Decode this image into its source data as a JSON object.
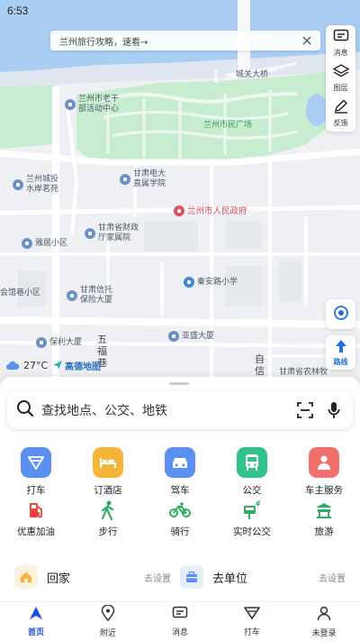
{
  "status_bar": {
    "time": "6:53"
  },
  "banner": {
    "text": "兰州旅行攻略，速看→"
  },
  "right_tools": [
    {
      "label": "消息",
      "icon": "message-icon"
    },
    {
      "label": "图层",
      "icon": "layers-icon"
    },
    {
      "label": "反馈",
      "icon": "feedback-icon"
    }
  ],
  "route_button": {
    "label": "路线"
  },
  "weather": {
    "temp": "27°C"
  },
  "map_logo": {
    "text": "高德地图"
  },
  "map_labels": {
    "bridge": "城关大桥",
    "senior_center": "兰州市老干\n部活动中心",
    "square": "兰州市民广场",
    "gansu_tv": "甘肃电大\n直属学院",
    "chengqiao": "兰州城投\n水岸茗苑",
    "gov": "兰州市人民政府",
    "finance": "甘肃省财政\n厅家属院",
    "yaju": "雅居小区",
    "qinan": "秦安路小学",
    "xintuo": "甘肃信托\n保险大厦",
    "huiguan": "会馆巷小区",
    "baoli": "保利大厦",
    "yasheng": "亚盛大厦",
    "wufu": "五\n福\n巷",
    "zixin": "自\n信\n路",
    "nongke": "甘肃省农林牧\n三厅家属院"
  },
  "search": {
    "placeholder": "查找地点、公交、地铁"
  },
  "services_primary": [
    {
      "label": "打车",
      "icon": "taxi-icon",
      "color": "#5a8ef0"
    },
    {
      "label": "订酒店",
      "icon": "hotel-icon",
      "color": "#f5b53a"
    },
    {
      "label": "驾车",
      "icon": "car-icon",
      "color": "#5b8ff0"
    },
    {
      "label": "公交",
      "icon": "bus-icon",
      "color": "#2fc28a"
    },
    {
      "label": "车主服务",
      "icon": "car-owner-icon",
      "color": "#f0706d"
    }
  ],
  "services_secondary": [
    {
      "label": "优惠加油",
      "icon": "fuel-icon",
      "color": "#e8453c"
    },
    {
      "label": "步行",
      "icon": "walk-icon",
      "color": "#2fae62"
    },
    {
      "label": "骑行",
      "icon": "bike-icon",
      "color": "#2fae62"
    },
    {
      "label": "实时公交",
      "icon": "realtime-bus-icon",
      "color": "#2fae62"
    },
    {
      "label": "旅游",
      "icon": "travel-icon",
      "color": "#2fae62"
    }
  ],
  "shortcuts": [
    {
      "name": "回家",
      "action": "去设置",
      "icon": "home-icon"
    },
    {
      "name": "去单位",
      "action": "去设置",
      "icon": "briefcase-icon"
    }
  ],
  "tabs": [
    {
      "label": "首页",
      "icon": "home-nav-icon",
      "active": true
    },
    {
      "label": "附近",
      "icon": "nearby-icon",
      "active": false
    },
    {
      "label": "消息",
      "icon": "message-icon",
      "active": false
    },
    {
      "label": "打车",
      "icon": "taxi-icon",
      "active": false
    },
    {
      "label": "未登录",
      "icon": "user-icon",
      "active": false
    }
  ]
}
